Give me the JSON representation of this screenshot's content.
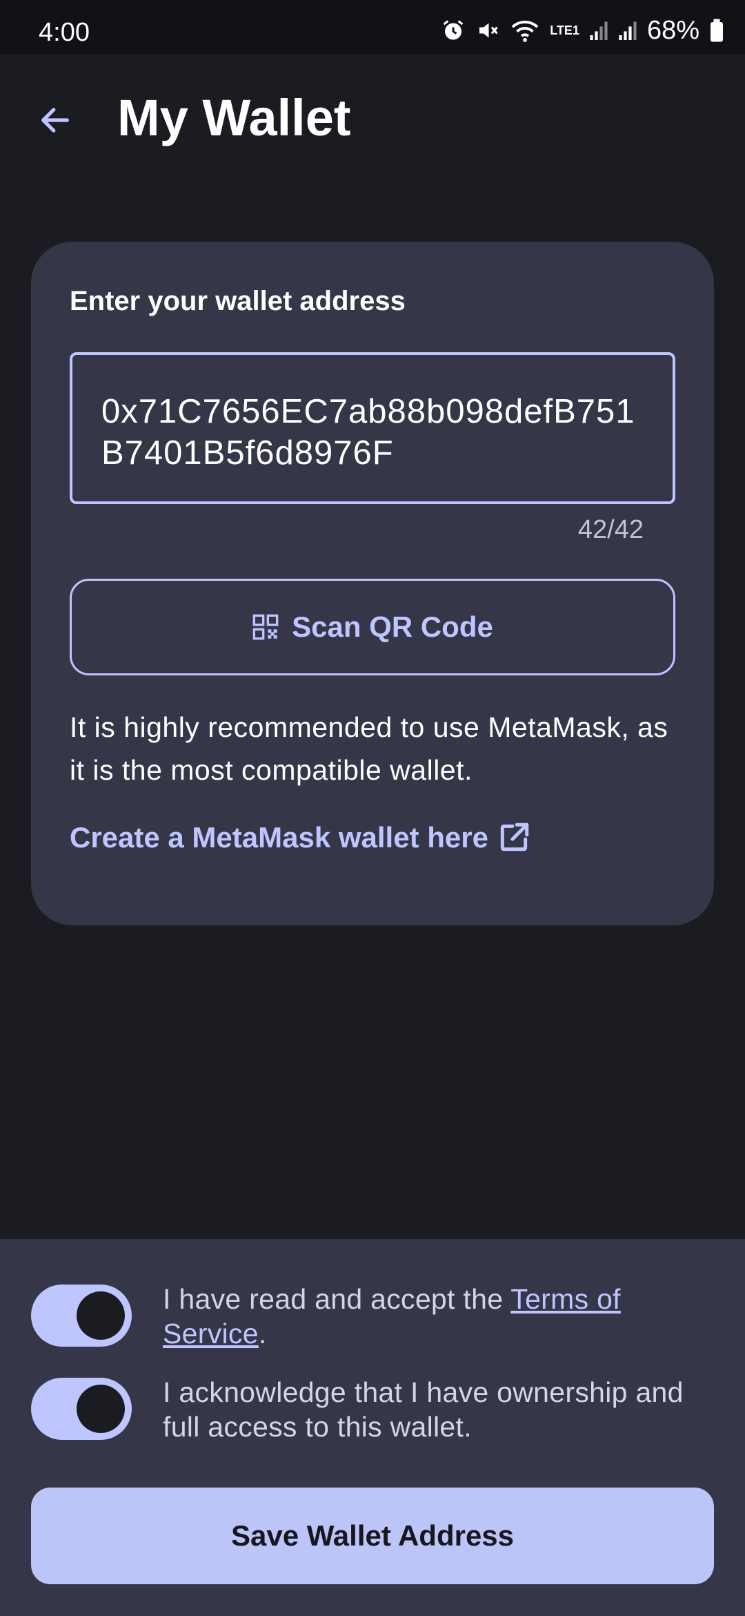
{
  "status_bar": {
    "time": "4:00",
    "network_label": "LTE1",
    "battery": "68%"
  },
  "header": {
    "title": "My Wallet",
    "back_icon": "arrow-back-icon"
  },
  "wallet_card": {
    "heading": "Enter your wallet address",
    "address_value": "0x71C7656EC7ab88b098defB751B7401B5f6d8976F",
    "char_count": "42/42",
    "scan_button_label": "Scan QR Code",
    "scan_icon": "qr-code-icon",
    "recommendation_text": "It is highly recommended to use MetaMask, as it is the most compatible wallet.",
    "metamask_link_label": "Create a MetaMask wallet here",
    "external_link_icon": "external-link-icon"
  },
  "agreements": {
    "terms_prefix": "I have read and accept the ",
    "terms_link": "Terms of Service",
    "terms_suffix": ".",
    "terms_enabled": true,
    "ownership_text": "I acknowledge that I have ownership and full access to this wallet.",
    "ownership_enabled": true
  },
  "actions": {
    "save_label": "Save Wallet Address"
  },
  "colors": {
    "background": "#1b1c22",
    "card": "#353749",
    "accent": "#bfc6ff",
    "primary_button": "#bcc4f8"
  }
}
